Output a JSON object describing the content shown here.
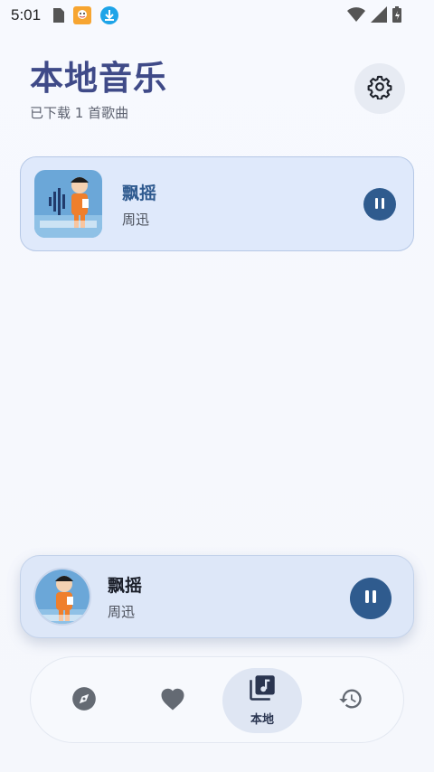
{
  "status_bar": {
    "time": "5:01",
    "icons_left": [
      "sim-card-icon",
      "app-notification-icon",
      "download-icon"
    ],
    "icons_right": [
      "wifi-icon",
      "signal-icon",
      "battery-icon"
    ]
  },
  "header": {
    "title": "本地音乐",
    "subtitle": "已下载 1 首歌曲",
    "settings_icon": "gear-icon"
  },
  "songs": [
    {
      "title": "飘摇",
      "artist": "周迅",
      "state": "playing"
    }
  ],
  "mini_player": {
    "title": "飘摇",
    "artist": "周迅",
    "state": "playing"
  },
  "bottom_nav": {
    "items": [
      {
        "icon": "compass-icon",
        "label": "",
        "active": false
      },
      {
        "icon": "heart-icon",
        "label": "",
        "active": false
      },
      {
        "icon": "music-library-icon",
        "label": "本地",
        "active": true
      },
      {
        "icon": "history-icon",
        "label": "",
        "active": false
      }
    ]
  },
  "colors": {
    "accent": "#2f5b8e",
    "title": "#3f4a88",
    "card_bg": "#dfe9fb",
    "nav_active_bg": "#dfe6f3"
  }
}
